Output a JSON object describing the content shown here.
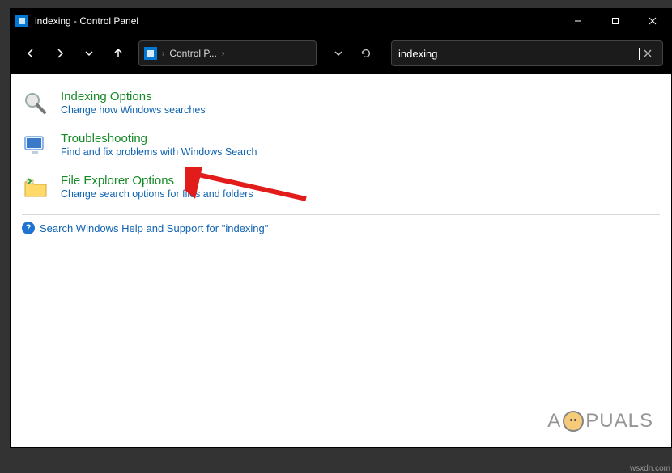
{
  "window": {
    "title": "indexing - Control Panel"
  },
  "breadcrumb": {
    "root_label": "Control P...",
    "chevron": "›"
  },
  "search": {
    "value": "indexing"
  },
  "results": [
    {
      "title": "Indexing Options",
      "desc": "Change how Windows searches"
    },
    {
      "title": "Troubleshooting",
      "desc": "Find and fix problems with Windows Search"
    },
    {
      "title": "File Explorer Options",
      "desc": "Change search options for files and folders"
    }
  ],
  "help_link": "Search Windows Help and Support for \"indexing\"",
  "watermark": {
    "pre": "A",
    "post": "PUALS"
  },
  "credit": "wsxdn.com"
}
